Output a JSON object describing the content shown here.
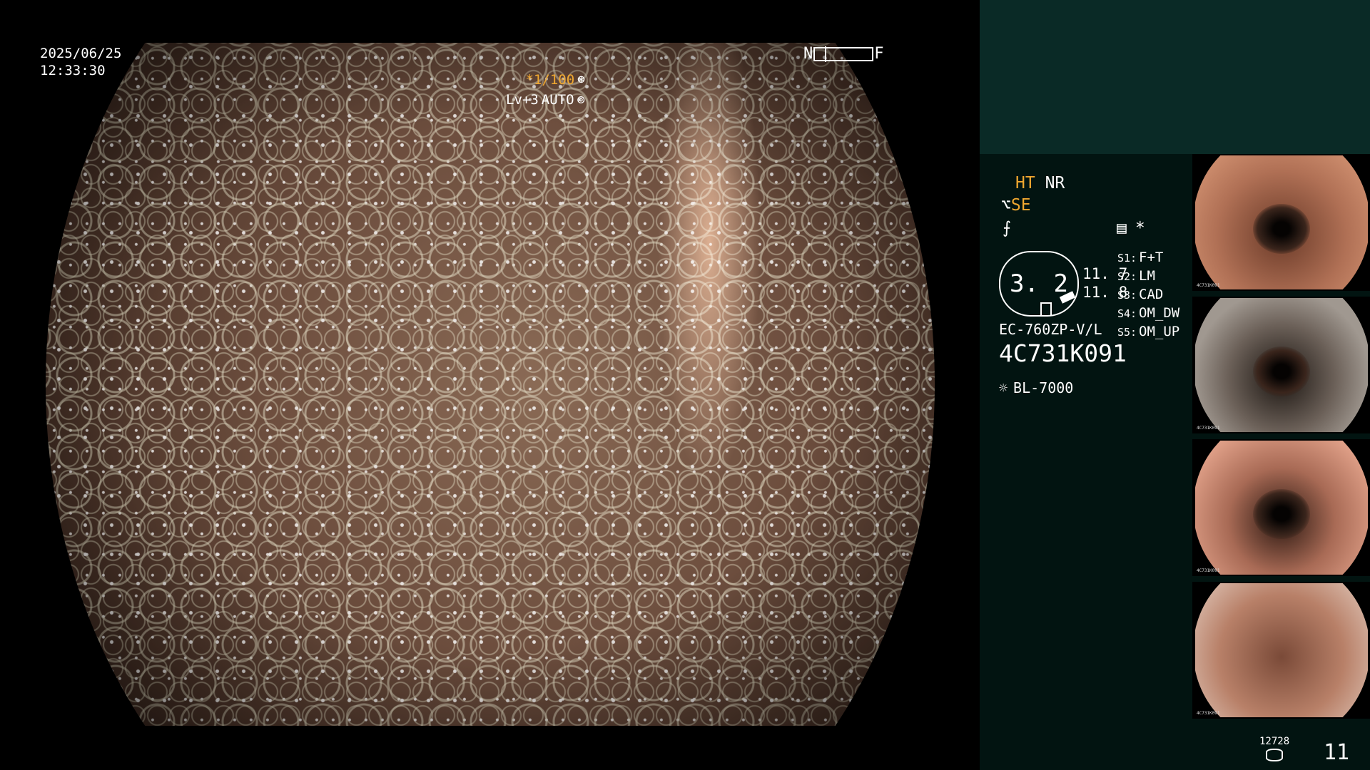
{
  "osd": {
    "date": "2025/06/25",
    "time": "12:33:30",
    "near_label": "N",
    "far_label": "F",
    "shutter": "*1/100",
    "level": "Lv+3",
    "mode": "AUTO"
  },
  "panel": {
    "ht": "HT",
    "nr": "NR",
    "se": "SE",
    "rec_star": "*",
    "zoom": "3. 2",
    "ratio_a": "11. 7",
    "ratio_b": "11. 8",
    "presets": [
      {
        "key": "S1:",
        "value": "F+T"
      },
      {
        "key": "S2:",
        "value": "LM"
      },
      {
        "key": "S3:",
        "value": "CAD"
      },
      {
        "key": "S4:",
        "value": "OM_DW"
      },
      {
        "key": "S5:",
        "value": "OM_UP"
      }
    ],
    "scope_model": "EC-760ZP-V/L",
    "scope_serial": "4C731K091",
    "light_source": "BL-7000",
    "thumb_tag": "4C731K091",
    "counter_small": "12728",
    "counter_big": "11"
  },
  "icons": {
    "aperture": "aperture-icon",
    "auto": "auto-iris-icon",
    "se": "structure-enhance-icon",
    "freeze": "freeze-icon",
    "record": "record-icon",
    "light": "lamp-icon",
    "storage": "storage-icon"
  },
  "colors": {
    "accent_orange": "#f0a830",
    "panel_bg": "#021411",
    "panel_top_bg": "#0a2a26"
  }
}
